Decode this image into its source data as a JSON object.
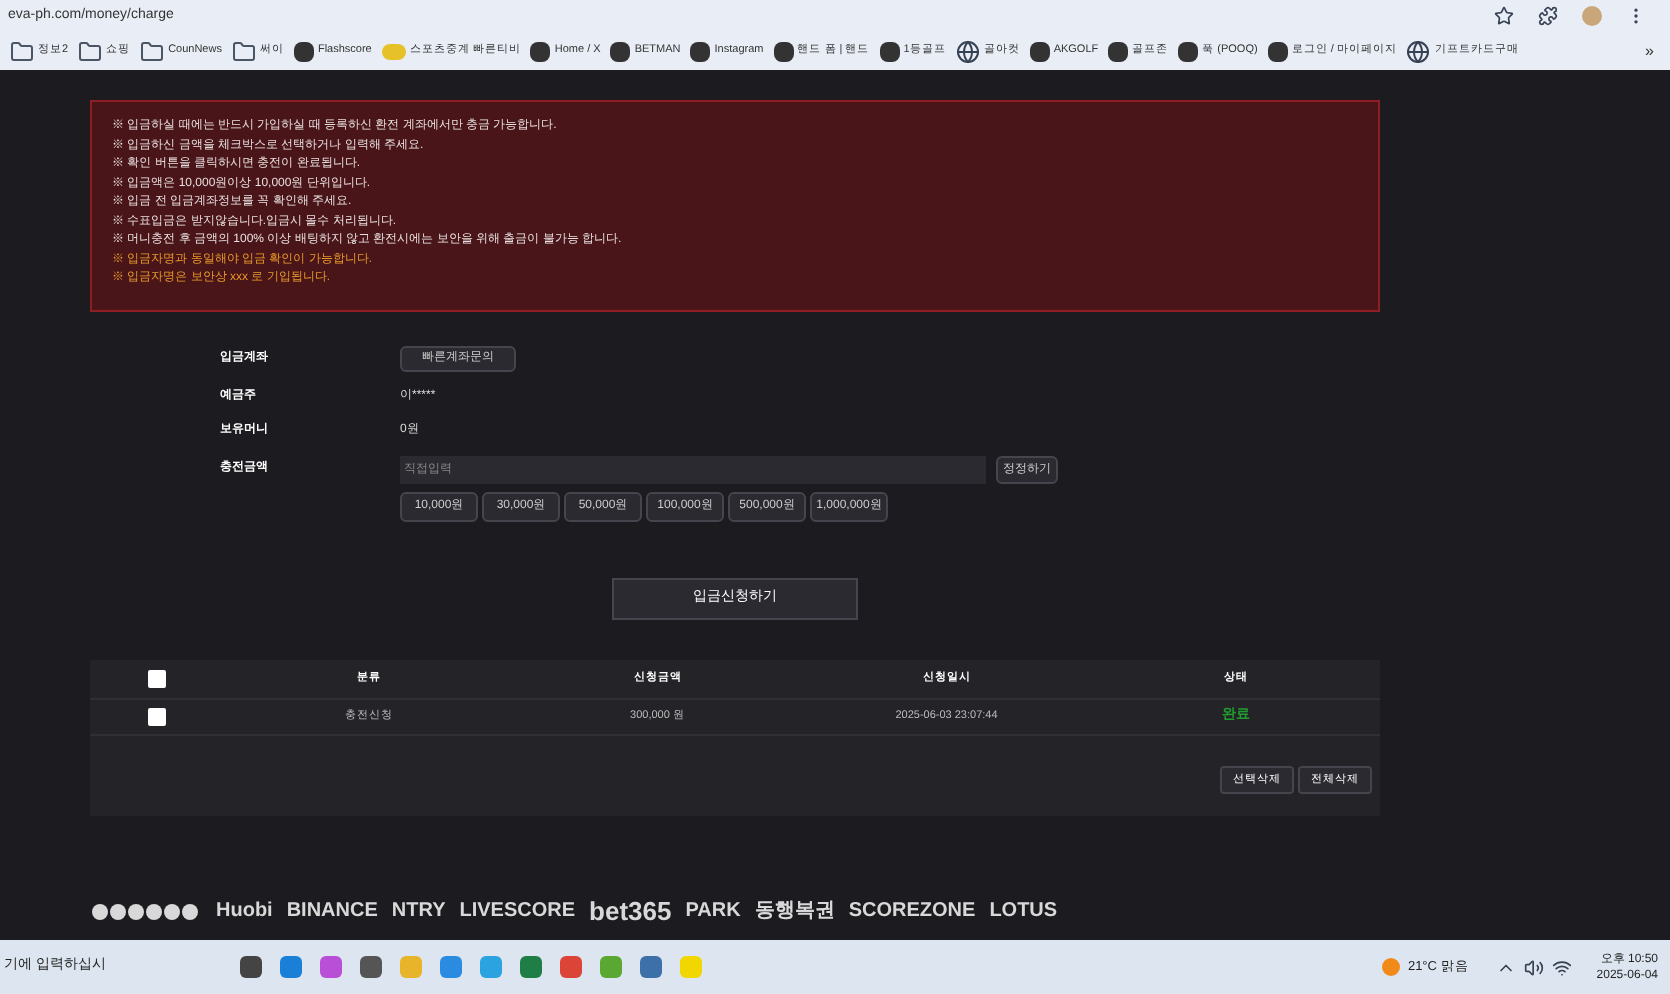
{
  "browser": {
    "url": "eva-ph.com/money/charge",
    "bookmarks": [
      {
        "label": "정보2",
        "kind": "folder"
      },
      {
        "label": "쇼핑",
        "kind": "folder"
      },
      {
        "label": "CounNews",
        "kind": "folder"
      },
      {
        "label": "써이",
        "kind": "folder"
      },
      {
        "label": "Flashscore",
        "kind": "site"
      },
      {
        "label": "스포츠중계 빠른티비",
        "kind": "tv"
      },
      {
        "label": "Home / X",
        "kind": "site"
      },
      {
        "label": "BETMAN",
        "kind": "site"
      },
      {
        "label": "Instagram",
        "kind": "site"
      },
      {
        "label": "핸드 폼 | 핸드",
        "kind": "site"
      },
      {
        "label": "1등골프",
        "kind": "site"
      },
      {
        "label": "골아컷",
        "kind": "globe"
      },
      {
        "label": "AKGOLF",
        "kind": "site"
      },
      {
        "label": "골프존",
        "kind": "site"
      },
      {
        "label": "푹 (POOQ)",
        "kind": "site"
      },
      {
        "label": "로그인 / 마이페이지",
        "kind": "site"
      },
      {
        "label": "기프트카드구매",
        "kind": "globe"
      }
    ],
    "more": "»"
  },
  "notices": [
    {
      "text": "※ 입금하실 때에는 반드시 가입하실 때 등록하신 환전 계좌에서만 충금 가능합니다.",
      "kind": "normal"
    },
    {
      "text": "※ 입금하신 금액을 체크박스로 선택하거나 입력해 주세요.",
      "kind": "normal"
    },
    {
      "text": "※ 확인 버튼을 클릭하시면 충전이 완료됩니다.",
      "kind": "normal"
    },
    {
      "text": "※ 입금액은 10,000원이상 10,000원 단위입니다.",
      "kind": "normal"
    },
    {
      "text": "※ 입금 전 입금계좌정보를 꼭 확인해 주세요.",
      "kind": "normal"
    },
    {
      "text": "※ 수표입금은 받지않습니다.입금시 몰수 처리됩니다.",
      "kind": "normal"
    },
    {
      "text": "※ 머니충전 후 금액의 100% 이상 배팅하지 않고 환전시에는 보안을 위해 출금이 불가능 합니다.",
      "kind": "normal"
    },
    {
      "text": "※ 입금자명과 동일해야 입금 확인이 가능합니다.",
      "kind": "warning"
    },
    {
      "text": "※ 입금자명은 보안상 xxx 로 기입됩니다.",
      "kind": "warning"
    }
  ],
  "form": {
    "account_label": "입금계좌",
    "account_button": "빠른계좌문의",
    "holder_label": "예금주",
    "holder_value": "이*****",
    "balance_label": "보유머니",
    "balance_value": "0원",
    "amount_label": "충전금액",
    "amount_field": {
      "placeholder": "직접입력"
    },
    "reset_button": "정정하기",
    "amounts": [
      "10,000원",
      "30,000원",
      "50,000원",
      "100,000원",
      "500,000원",
      "1,000,000원"
    ],
    "submit": "입금신청하기"
  },
  "table": {
    "columns": [
      "분류",
      "신청금액",
      "신청일시",
      "상태"
    ],
    "header_checked": false,
    "rows": [
      {
        "checked": false,
        "type": "충전신청",
        "amount": "300,000 원",
        "date": "2025-06-03 23:07:44",
        "status": "완료",
        "color": "#1f9e2e"
      }
    ],
    "buttons": [
      "선택삭제",
      "전체삭제"
    ]
  },
  "partners": [
    "Huobi",
    "BINANCE",
    "NTRY",
    "LIVESCORE",
    "bet365",
    "PARK",
    "동행복권",
    "SCOREZONE",
    "LOTUS"
  ],
  "taskbar": {
    "search": "기에 입력하십시",
    "weather": "21°C 맑음",
    "time": "오후 10:50",
    "date": "2025-06-04"
  }
}
